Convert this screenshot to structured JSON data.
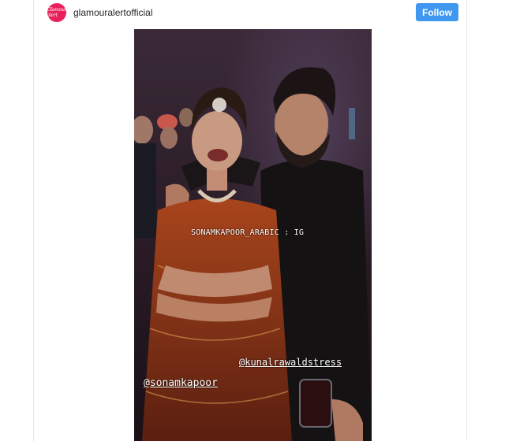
{
  "post": {
    "username": "glamouralertofficial",
    "avatar_text": "Glamour alert",
    "avatar_color": "#e8215a",
    "follow_label": "Follow",
    "follow_color": "#3f97f0"
  },
  "photo": {
    "credit_text": "SONAMKAPOOR_ARABIC : IG",
    "mentions": [
      "@kunalrawaldstress",
      "@sonamkapoor"
    ]
  }
}
